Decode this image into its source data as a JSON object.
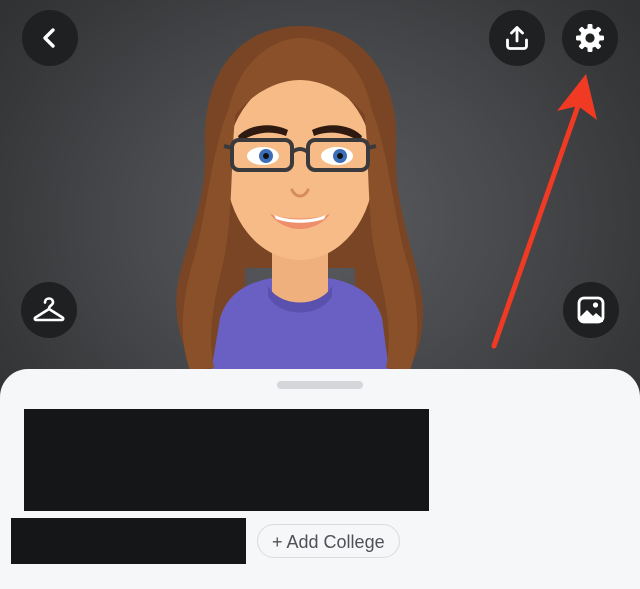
{
  "header": {
    "back_icon": "chevron-left-icon",
    "share_icon": "upload-icon",
    "settings_icon": "gear-icon"
  },
  "avatar_tools": {
    "outfit_icon": "hanger-icon",
    "background_icon": "image-icon"
  },
  "profile": {
    "add_college_label": "+ Add College"
  },
  "colors": {
    "button_bg": "#1f2022",
    "icon": "#ffffff",
    "annotation_arrow": "#f03a24",
    "sheet_bg": "#f6f7f9",
    "redaction": "#151618",
    "pill_border": "#d9dbdf",
    "pill_text": "#4f5156"
  }
}
